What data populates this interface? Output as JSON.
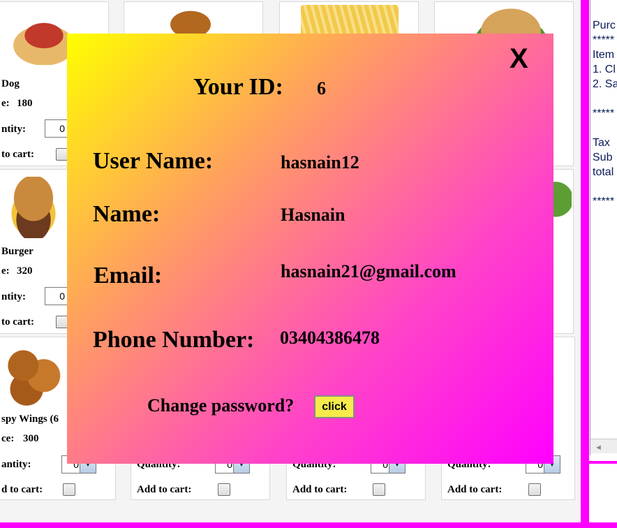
{
  "menu": {
    "items": [
      {
        "name": "Dog",
        "price_label": "e:",
        "price": "180",
        "qty_label": "ntity:",
        "qty": "0",
        "cart_label": "to cart:"
      },
      {
        "name": "Burger",
        "price_label": "e:",
        "price": "320",
        "qty_label": "ntity:",
        "qty": "0",
        "cart_label": "to cart:"
      },
      {
        "name": "spy Wings (6",
        "price_label": "ce:",
        "price": "300",
        "qty_label": "antity:",
        "qty": "0",
        "cart_label": "d to cart:"
      }
    ],
    "bottom_row": [
      {
        "qty_label": "Quantity:",
        "qty": "0",
        "cart_label": "Add to cart:"
      },
      {
        "qty_label": "Quantity:",
        "qty": "0",
        "cart_label": "Add to cart:"
      },
      {
        "qty_label": "Quantity:",
        "qty": "0",
        "cart_label": "Add to cart:"
      }
    ]
  },
  "receipt": {
    "lines": [
      "Purc",
      "*****",
      "Item",
      "1. Cl",
      "2. Sa",
      "",
      "*****",
      "",
      "Tax",
      "Sub",
      "total",
      "",
      "*****"
    ]
  },
  "profile": {
    "close": "X",
    "id_label": "Your ID:",
    "id_value": "6",
    "username_label": "User Name:",
    "username_value": "hasnain12",
    "name_label": "Name:",
    "name_value": "Hasnain",
    "email_label": "Email:",
    "email_value": "hasnain21@gmail.com",
    "phone_label": "Phone Number:",
    "phone_value": "03404386478",
    "change_password_label": "Change password?",
    "click_button": "click"
  },
  "colors": {
    "frame_accent": "#ff00ff",
    "modal_gradient_start": "#ffff00",
    "modal_gradient_end": "#ff00ff",
    "click_button_bg": "#f6eb4a"
  }
}
